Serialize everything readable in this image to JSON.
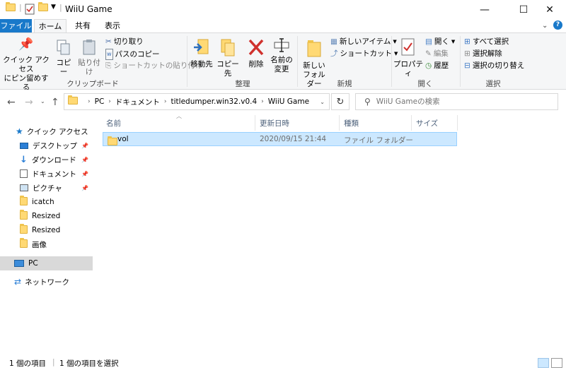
{
  "window": {
    "title": "WiiU Game",
    "controls": {
      "minimize": "—",
      "maximize": "☐",
      "close": "✕"
    }
  },
  "ribbon_tabs": [
    {
      "label": "ファイル"
    },
    {
      "label": "ホーム"
    },
    {
      "label": "共有"
    },
    {
      "label": "表示"
    }
  ],
  "ribbon": {
    "clipboard": {
      "pin_quick_access": [
        "クイック アクセス",
        "にピン留めする"
      ],
      "copy": "コピー",
      "paste": "貼り付け",
      "cut": "切り取り",
      "copy_path": "パスのコピー",
      "paste_shortcut": "ショートカットの貼り付け",
      "group_title": "クリップボード"
    },
    "organize": {
      "move_to": "移動先",
      "copy_to": "コピー先",
      "delete": "削除",
      "rename": [
        "名前の",
        "変更"
      ],
      "group_title": "整理"
    },
    "new": {
      "new_folder": [
        "新しい",
        "フォルダー"
      ],
      "new_item": "新しいアイテム",
      "easy_access": "ショートカット",
      "group_title": "新規"
    },
    "open": {
      "properties": "プロパティ",
      "open": "開く",
      "edit": "編集",
      "history": "履歴",
      "group_title": "開く"
    },
    "select": {
      "select_all": "すべて選択",
      "select_none": "選択解除",
      "invert_selection": "選択の切り替え",
      "group_title": "選択"
    }
  },
  "address": {
    "breadcrumbs": [
      "PC",
      "ドキュメント",
      "titledumper.win32.v0.4",
      "WiiU Game"
    ],
    "search_placeholder": "WiiU Gameの検索"
  },
  "nav": {
    "quick_access": "クイック アクセス",
    "items": [
      {
        "label": "デスクトップ",
        "pinned": true,
        "icon": "desktop-icon"
      },
      {
        "label": "ダウンロード",
        "pinned": true,
        "icon": "download-icon"
      },
      {
        "label": "ドキュメント",
        "pinned": true,
        "icon": "documents-icon"
      },
      {
        "label": "ピクチャ",
        "pinned": true,
        "icon": "pictures-icon"
      },
      {
        "label": "icatch",
        "pinned": false,
        "icon": "folder-icon"
      },
      {
        "label": "Resized",
        "pinned": false,
        "icon": "folder-icon"
      },
      {
        "label": "Resized",
        "pinned": false,
        "icon": "folder-icon"
      },
      {
        "label": "画像",
        "pinned": false,
        "icon": "folder-icon"
      }
    ],
    "pc": "PC",
    "network": "ネットワーク"
  },
  "columns": [
    "名前",
    "更新日時",
    "種類",
    "サイズ"
  ],
  "files": [
    {
      "name": "vol",
      "modified": "2020/09/15 21:44",
      "type": "ファイル フォルダー",
      "size": ""
    }
  ],
  "status": {
    "item_count": "1 個の項目",
    "selected": "1 個の項目を選択"
  },
  "colors": {
    "file_tab": "#1979ca",
    "selection": "#cce8ff",
    "selection_border": "#99d1ff",
    "ribbon_bg": "#f5f6f7"
  }
}
